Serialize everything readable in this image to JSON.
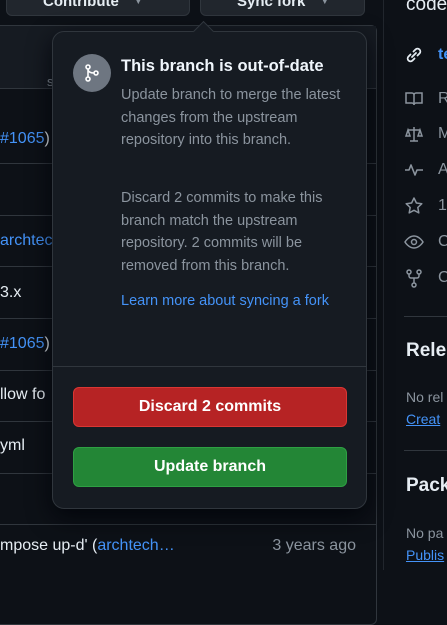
{
  "topbar": {
    "contribute_label": "Contribute",
    "sync_fork_label": "Sync fork",
    "repo_title_fragment": "code"
  },
  "file_list": {
    "header_fragment": "s",
    "fragments": [
      {
        "pre": "",
        "link": "#1065",
        "post": ")"
      },
      {
        "pre": "",
        "link": "archtec",
        "post": ""
      },
      {
        "pre": "3.x",
        "link": "",
        "post": ""
      },
      {
        "pre": "",
        "link": "#1065",
        "post": ")"
      },
      {
        "pre": "llow fo",
        "link": "",
        "post": ""
      },
      {
        "pre": "yml",
        "link": "",
        "post": ""
      }
    ],
    "last_row": {
      "message_prefix": "mpose up-d' (",
      "message_link": "archtech…",
      "age": "3 years ago"
    }
  },
  "sidebar": {
    "website_fragment": "te",
    "about_rows": [
      "R",
      "M",
      "A",
      "1",
      "C",
      "C"
    ],
    "releases_heading": "Rele",
    "releases_text": "No rel",
    "releases_link": "Creat",
    "packages_heading": "Pack",
    "packages_text": "No pa",
    "packages_link": "Publis"
  },
  "popover": {
    "title": "This branch is out-of-date",
    "description_1": "Update branch to merge the latest changes from the upstream repository into this branch.",
    "description_2": "Discard 2 commits to make this branch match the upstream repository. 2 commits will be removed from this branch.",
    "learn_more": "Learn more about syncing a fork",
    "discard_button": "Discard 2 commits",
    "update_button": "Update branch",
    "icon": "git-branch-icon"
  },
  "colors": {
    "background": "#0d1117",
    "popover_bg": "#161b22",
    "link": "#4493f8",
    "danger": "#b62324",
    "primary": "#238636"
  }
}
